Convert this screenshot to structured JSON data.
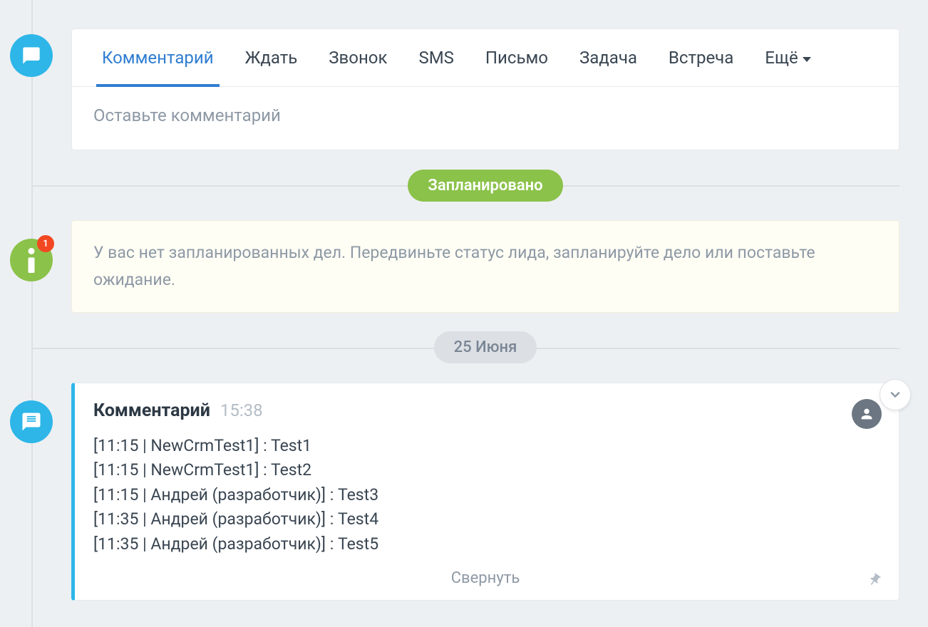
{
  "tabs": {
    "comment": "Комментарий",
    "wait": "Ждать",
    "call": "Звонок",
    "sms": "SMS",
    "mail": "Письмо",
    "task": "Задача",
    "meeting": "Встреча",
    "more": "Ещё"
  },
  "comment_input": {
    "placeholder": "Оставьте комментарий"
  },
  "status_planned": "Запланировано",
  "info_message": "У вас нет запланированных дел. Передвиньте статус лида, запланируйте дело или поставьте ожидание.",
  "info_badge": "1",
  "date_divider": "25 Июня",
  "comment_entry": {
    "title": "Комментарий",
    "time": "15:38",
    "lines": [
      "[11:15 | NewCrmTest1] : Test1",
      "[11:15 | NewCrmTest1] : Test2",
      "[11:15 | Андрей (разработчик)] : Test3",
      "[11:35 | Андрей (разработчик)] : Test4",
      "[11:35 | Андрей (разработчик)] : Test5"
    ],
    "collapse": "Свернуть"
  }
}
